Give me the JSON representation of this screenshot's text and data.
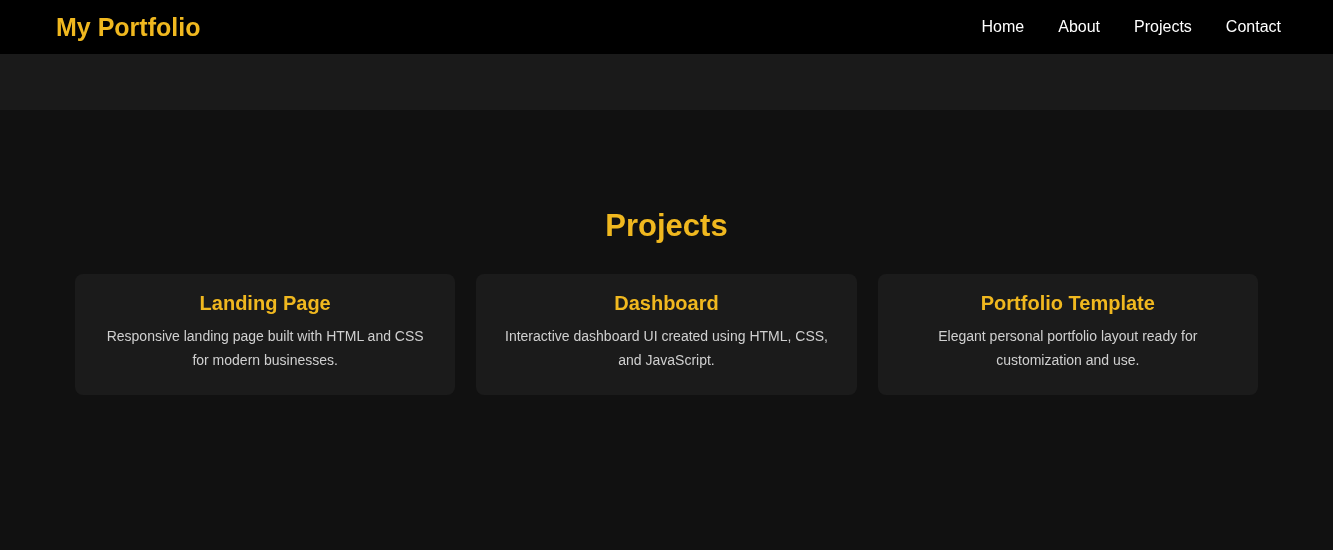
{
  "header": {
    "logo": "My Portfolio",
    "nav": [
      "Home",
      "About",
      "Projects",
      "Contact"
    ]
  },
  "projects": {
    "title": "Projects",
    "cards": [
      {
        "title": "Landing Page",
        "description": "Responsive landing page built with HTML and CSS for modern businesses."
      },
      {
        "title": "Dashboard",
        "description": "Interactive dashboard UI created using HTML, CSS, and JavaScript."
      },
      {
        "title": "Portfolio Template",
        "description": "Elegant personal portfolio layout ready for customization and use."
      }
    ]
  }
}
